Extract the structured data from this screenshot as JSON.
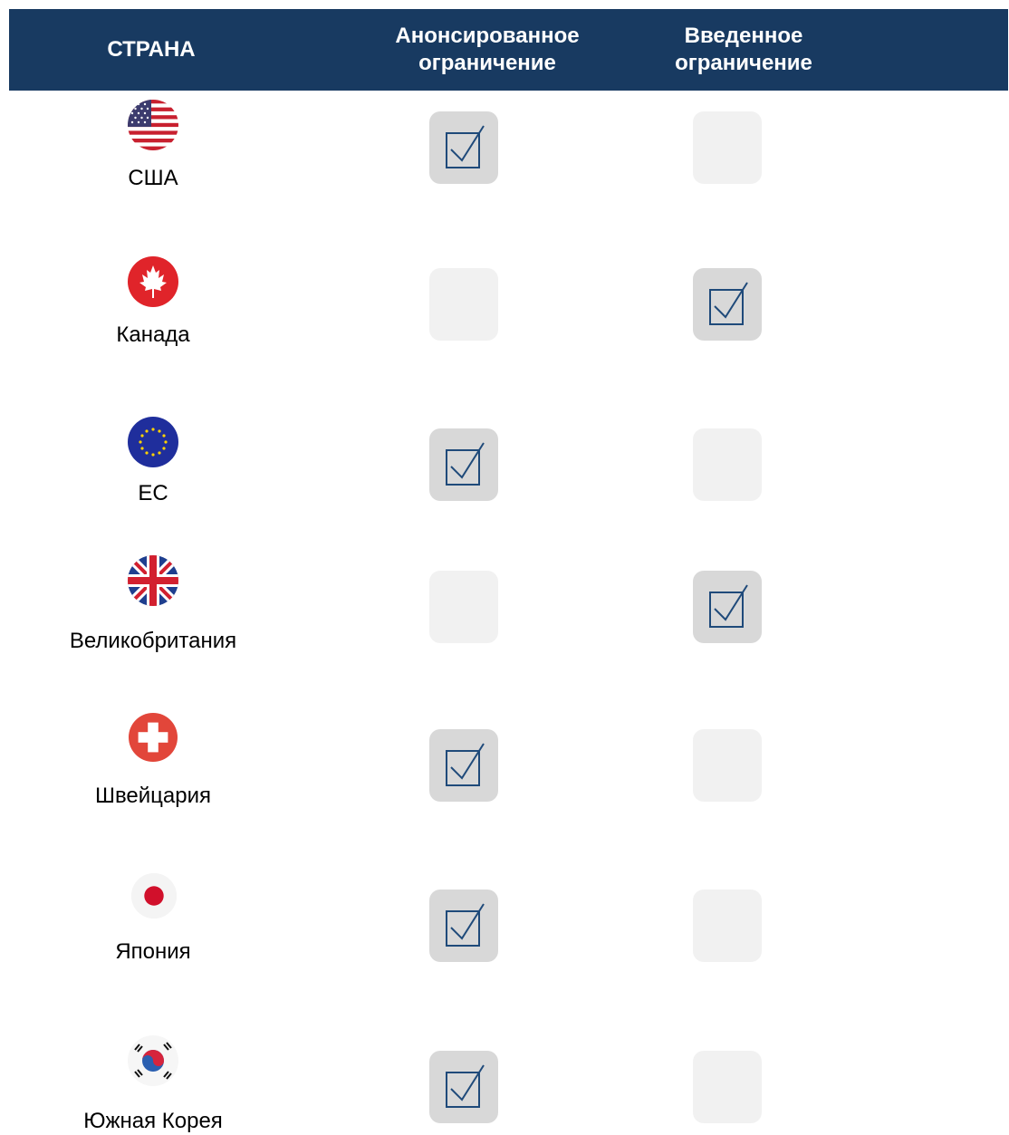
{
  "header": {
    "country": "СТРАНА",
    "announced": "Анонсированное\nограничение",
    "imposed": "Введенное\nограничение"
  },
  "rows": [
    {
      "name": "США",
      "flag_icon": "us-flag-icon",
      "announced": true,
      "imposed": false
    },
    {
      "name": "Канада",
      "flag_icon": "canada-flag-icon",
      "announced": false,
      "imposed": true
    },
    {
      "name": "ЕС",
      "flag_icon": "eu-flag-icon",
      "announced": true,
      "imposed": false
    },
    {
      "name": "Великобритания",
      "flag_icon": "uk-flag-icon",
      "announced": false,
      "imposed": true
    },
    {
      "name": "Швейцария",
      "flag_icon": "switzerland-flag-icon",
      "announced": true,
      "imposed": false
    },
    {
      "name": "Япония",
      "flag_icon": "japan-flag-icon",
      "announced": true,
      "imposed": false
    },
    {
      "name": "Южная Корея",
      "flag_icon": "south-korea-flag-icon",
      "announced": true,
      "imposed": false
    }
  ],
  "colors": {
    "header_bg": "#183a61",
    "check_color": "#1f4a7a",
    "box_checked": "#d8d8d8",
    "box_empty": "#f1f1f1"
  }
}
